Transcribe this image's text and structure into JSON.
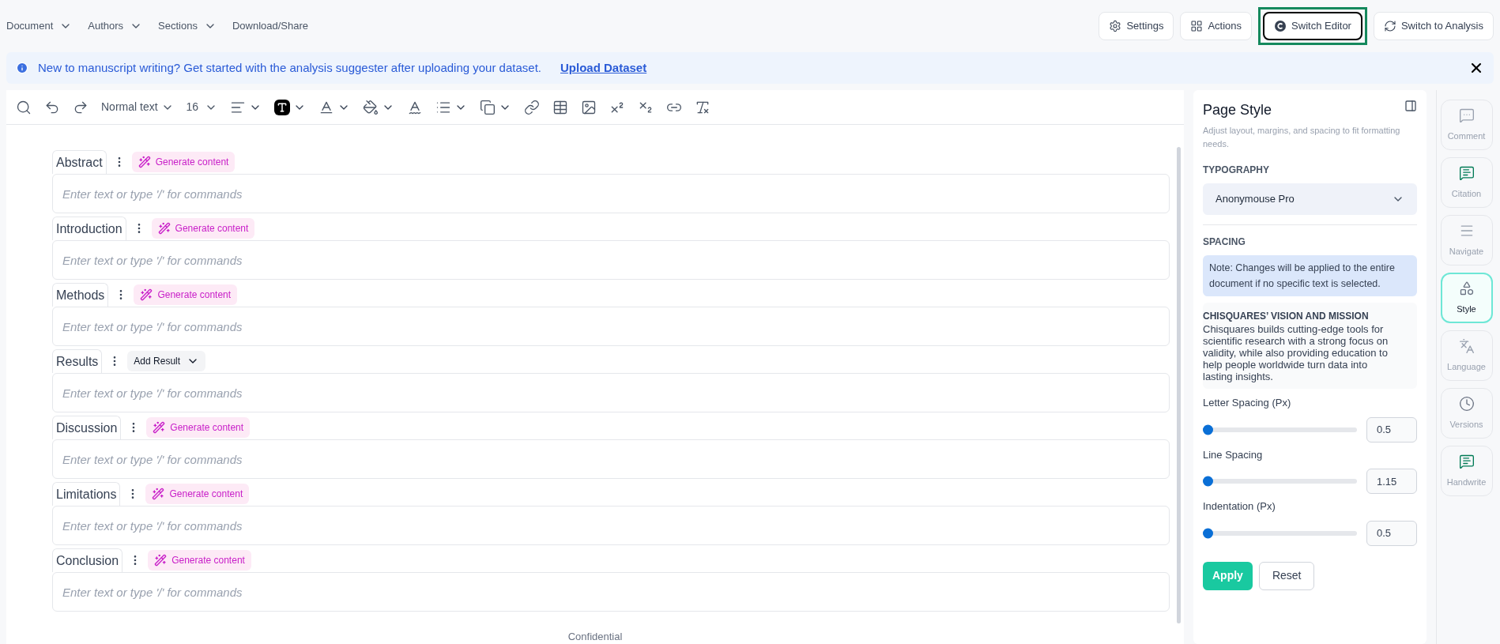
{
  "nav": {
    "menus": [
      {
        "label": "Document",
        "kind": "dropdown"
      },
      {
        "label": "Authors",
        "kind": "dropdown"
      },
      {
        "label": "Sections",
        "kind": "dropdown"
      },
      {
        "label": "Download/Share",
        "kind": "link"
      }
    ],
    "buttons": [
      {
        "label": "Settings",
        "highlighted": false
      },
      {
        "label": "Actions",
        "highlighted": false
      },
      {
        "label": "Switch Editor",
        "highlighted": true
      },
      {
        "label": "Switch to Analysis",
        "highlighted": false
      }
    ]
  },
  "banner": {
    "message": "New to manuscript writing? Get started with the analysis suggester after uploading your dataset.",
    "link": "Upload Dataset"
  },
  "toolbar": {
    "block_style": "Normal text",
    "font_size": "16"
  },
  "editor": {
    "footer": "Confidential",
    "sections": [
      {
        "title": "Abstract",
        "kind": "generate",
        "action": "Generate content",
        "placeholder": "Enter text or type '/' for commands"
      },
      {
        "title": "Introduction",
        "kind": "generate",
        "action": "Generate content",
        "placeholder": "Enter text or type '/' for commands"
      },
      {
        "title": "Methods",
        "kind": "generate",
        "action": "Generate content",
        "placeholder": "Enter text or type '/' for commands"
      },
      {
        "title": "Results",
        "kind": "add_result",
        "action": "Add Result",
        "placeholder": "Enter text or type '/' for commands"
      },
      {
        "title": "Discussion",
        "kind": "generate",
        "action": "Generate content",
        "placeholder": "Enter text or type '/' for commands"
      },
      {
        "title": "Limitations",
        "kind": "generate",
        "action": "Generate content",
        "placeholder": "Enter text or type '/' for commands"
      },
      {
        "title": "Conclusion",
        "kind": "generate",
        "action": "Generate content",
        "placeholder": "Enter text or type '/' for commands"
      }
    ]
  },
  "panel": {
    "title": "Page Style",
    "subtitle": "Adjust layout, margins, and spacing to fit formatting needs.",
    "typography_label": "TYPOGRAPHY",
    "font": "Anonymouse Pro",
    "spacing_label": "SPACING",
    "note": "Note: Changes will be applied to the entire document if no specific text is selected.",
    "vision_title": "CHISQUARES’ VISION AND MISSION",
    "vision_body": "Chisquares builds cutting-edge tools for scientific research with a strong focus on validity, while also providing education to help people worldwide turn data into lasting insights.",
    "sliders": [
      {
        "label": "Letter Spacing (Px)",
        "level": 0,
        "value": "0.5"
      },
      {
        "label": "Line Spacing",
        "level": 0,
        "value": "1.15"
      },
      {
        "label": "Indentation (Px)",
        "level": 0,
        "value": "0.5"
      }
    ],
    "apply": "Apply",
    "reset": "Reset"
  },
  "rail": [
    {
      "label": "Comment",
      "selected": false
    },
    {
      "label": "Citation",
      "selected": false
    },
    {
      "label": "Navigate",
      "selected": false
    },
    {
      "label": "Style",
      "selected": true
    },
    {
      "label": "Language",
      "selected": false
    },
    {
      "label": "Versions",
      "selected": false
    },
    {
      "label": "Handwrite",
      "selected": false
    }
  ]
}
